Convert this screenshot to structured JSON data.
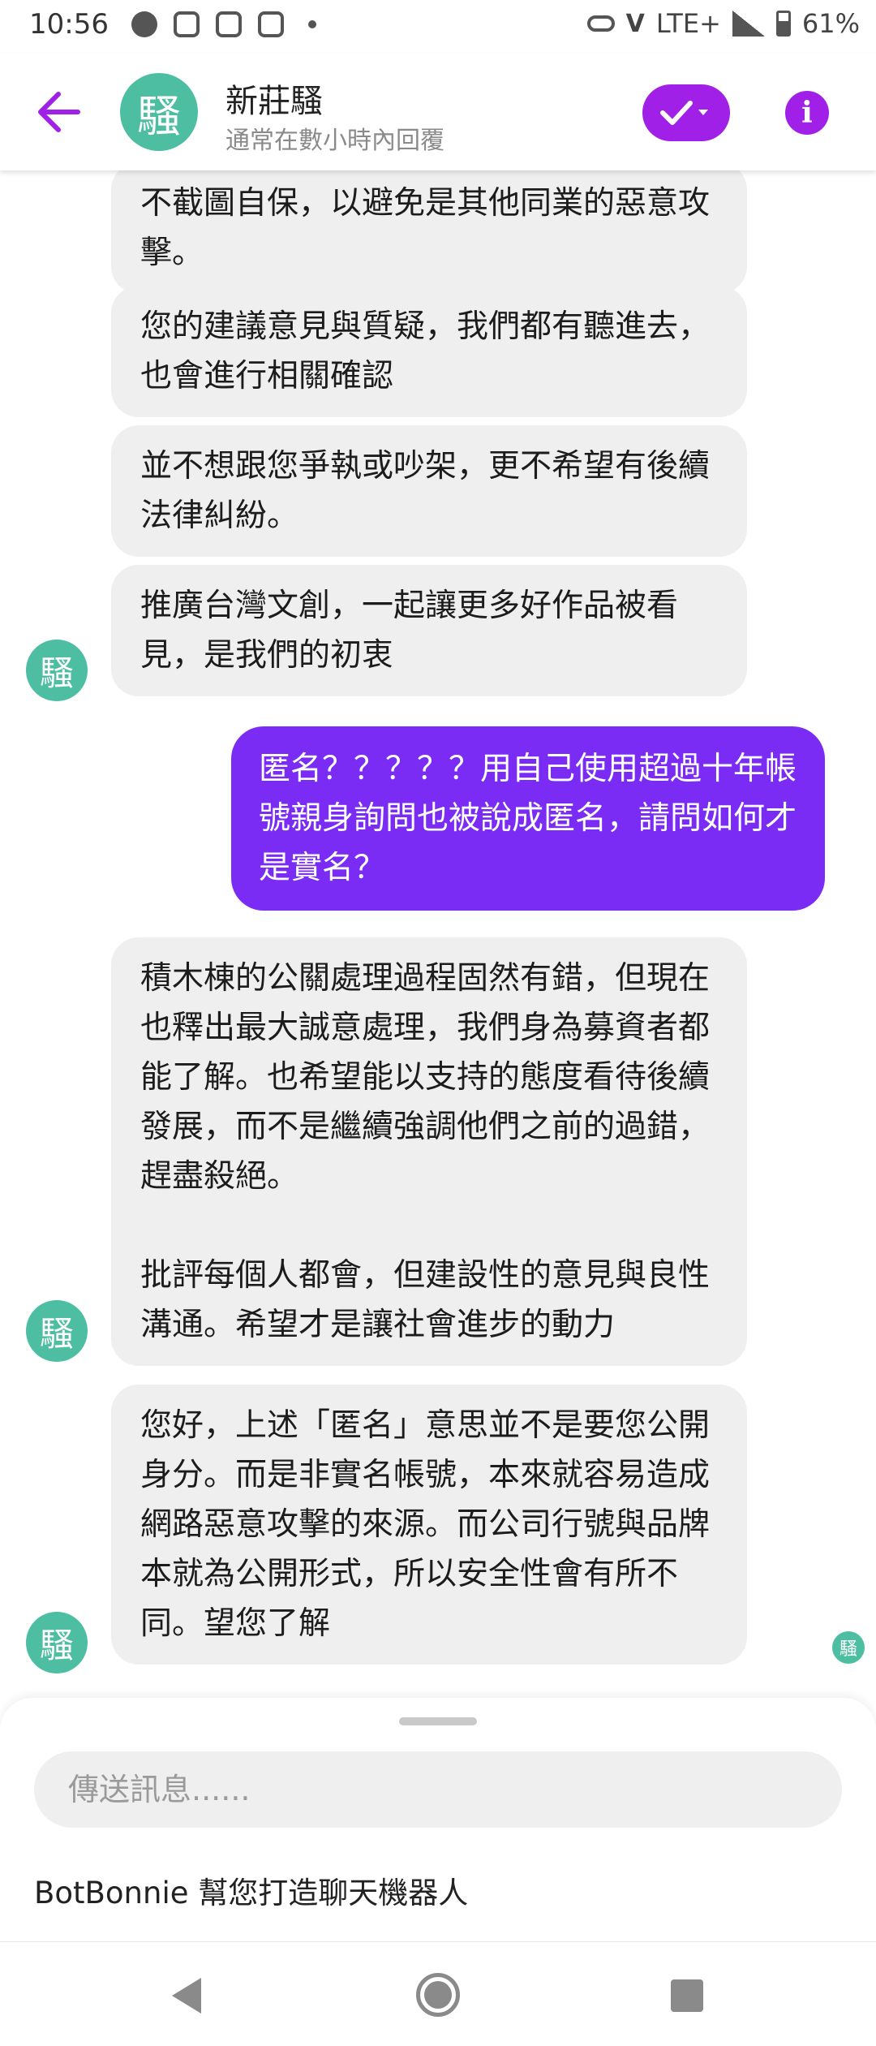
{
  "status_bar": {
    "time": "10:56",
    "network": "LTE+",
    "battery": "61%",
    "volte": "V"
  },
  "header": {
    "avatar_glyph": "騷",
    "title": "新莊騷",
    "subtitle": "通常在數小時內回覆"
  },
  "messages": [
    {
      "direction": "incoming",
      "text": "不截圖自保，以避免是其他同業的惡意攻擊。"
    },
    {
      "direction": "incoming",
      "text": "您的建議意見與質疑，我們都有聽進去，也會進行相關確認"
    },
    {
      "direction": "incoming",
      "text": "並不想跟您爭執或吵架，更不希望有後續法律糾紛。"
    },
    {
      "direction": "incoming",
      "text": "推廣台灣文創，一起讓更多好作品被看見，是我們的初衷"
    },
    {
      "direction": "outgoing",
      "text": "匿名？？？？？用自己使用超過十年帳號親身詢問也被說成匿名，請問如何才是實名？"
    },
    {
      "direction": "incoming",
      "text": "積木棟的公關處理過程固然有錯，但現在也釋出最大誠意處理，我們身為募資者都能了解。也希望能以支持的態度看待後續發展，而不是繼續強調他們之前的過錯，趕盡殺絕。\n\n批評每個人都會，但建設性的意見與良性溝通。希望才是讓社會進步的動力"
    },
    {
      "direction": "incoming",
      "text": "您好，上述「匿名」意思並不是要您公開身分。而是非實名帳號，本來就容易造成網路惡意攻擊的來源。而公司行號與品牌本就為公開形式，所以安全性會有所不同。望您了解"
    }
  ],
  "composer": {
    "placeholder": "傳送訊息......",
    "footer": "BotBonnie 幫您打造聊天機器人"
  },
  "colors": {
    "accent": "#a020e8",
    "outgoing_bubble": "#7a2cf5",
    "incoming_bubble": "#efefef",
    "avatar": "#4dbea2"
  }
}
